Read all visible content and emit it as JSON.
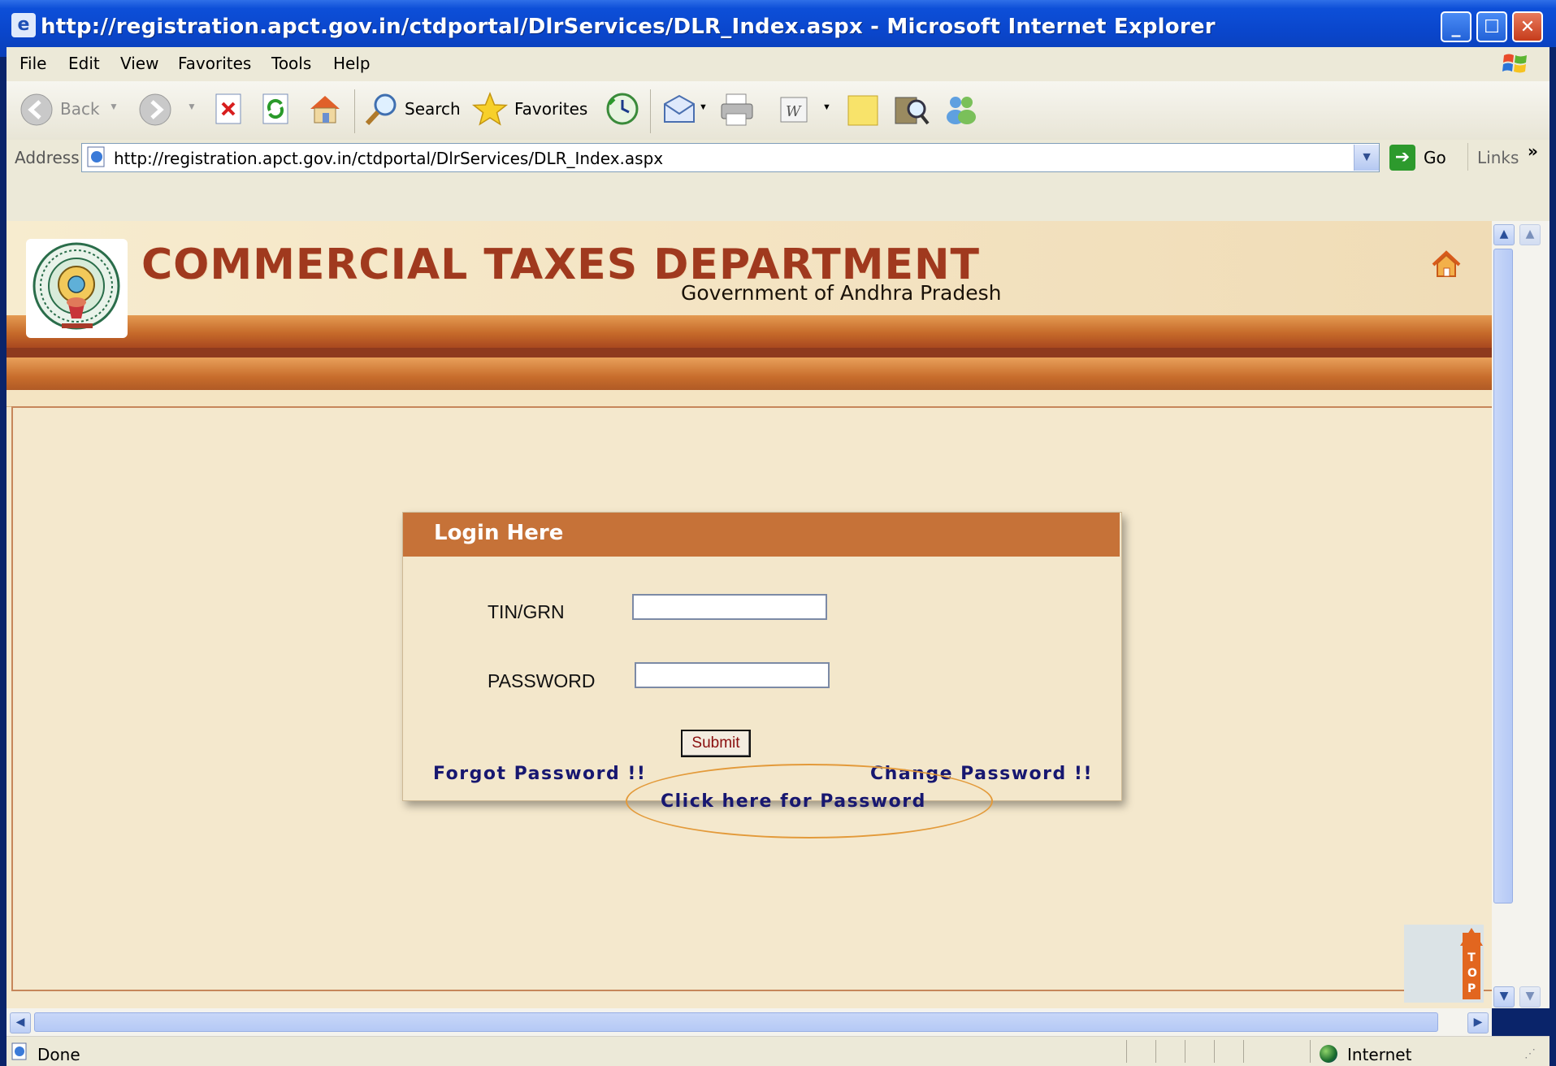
{
  "window": {
    "title": "http://registration.apct.gov.in/ctdportal/DlrServices/DLR_Index.aspx - Microsoft Internet Explorer",
    "min_glyph": "_",
    "max_glyph": "☐",
    "close_glyph": "✕"
  },
  "menu": [
    "File",
    "Edit",
    "View",
    "Favorites",
    "Tools",
    "Help"
  ],
  "toolbar": {
    "back_label": "Back",
    "search_label": "Search",
    "favorites_label": "Favorites"
  },
  "address": {
    "label": "Address",
    "url": "http://registration.apct.gov.in/ctdportal/DlrServices/DLR_Index.aspx",
    "go_label": "Go",
    "links_label": "Links",
    "links_chevron": "»"
  },
  "header": {
    "title": "COMMERCIAL TAXES DEPARTMENT",
    "subtitle": "Government of Andhra Pradesh"
  },
  "login": {
    "title": "Login Here",
    "tin_label": "TIN/GRN",
    "tin_value": "",
    "password_label": "PASSWORD",
    "password_value": "",
    "submit_label": "Submit",
    "forgot_link": "Forgot Password !!",
    "change_link": "Change Password !!",
    "click_here_link": "Click here for Password"
  },
  "top_widget": {
    "letters": "TOP"
  },
  "status": {
    "text": "Done",
    "zone": "Internet"
  },
  "colors": {
    "accent_orange": "#c67238",
    "dept_title": "#a0391e",
    "link_blue": "#171770",
    "page_bg": "#f4e8cd",
    "highlight_oval": "#e39a3a"
  }
}
